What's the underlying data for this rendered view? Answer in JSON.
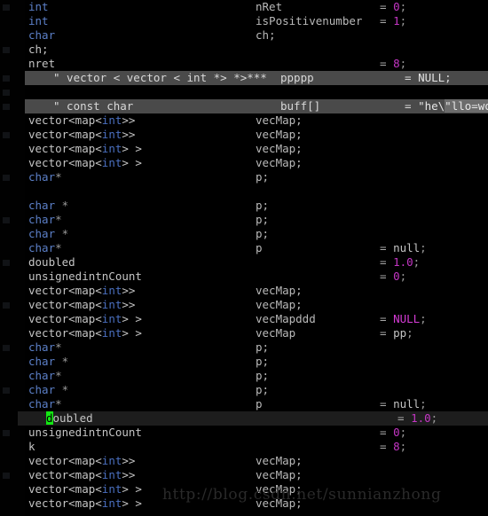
{
  "editor": {
    "background_color": "#000000",
    "highlight_color": "#4a4a4a",
    "current_line_color": "#1d1d1d",
    "cursor_color": "#13e813",
    "keyword_color": "#5b7fc7",
    "number_color": "#c536c5",
    "text_color": "#c4c4c4"
  },
  "watermark": {
    "text": "http://blog.csdn.net/sunnianzhong"
  },
  "lines": [
    {
      "type": "int",
      "name": "nRet",
      "op": "=",
      "value": "0",
      "term": ";"
    },
    {
      "type": "int",
      "name": "isPositivenumber",
      "op": "=",
      "value": "1",
      "term": ";"
    },
    {
      "type": "char",
      "name": "ch;",
      "op": "",
      "value": "",
      "term": ""
    },
    {
      "type": "ch;",
      "name": "",
      "op": "",
      "value": "",
      "term": ""
    },
    {
      "type": "nret",
      "name": "",
      "op": "=",
      "value": "8",
      "term": ";"
    },
    {
      "type": "\" vector < vector < int *> *>***",
      "name": "ppppp",
      "op": "=",
      "value": "NULL",
      "term": ";"
    },
    {
      "type": "",
      "name": "",
      "op": "",
      "value": "",
      "term": ""
    },
    {
      "type": "\" const char",
      "name": "buff[]",
      "op": "=",
      "value": "\"he\\\"llo=world\"",
      "term": ""
    },
    {
      "type": "vector<map<int>>",
      "name": "vecMap;",
      "op": "",
      "value": "",
      "term": ""
    },
    {
      "type": "vector<map<int>>",
      "name": "vecMap;",
      "op": "",
      "value": "",
      "term": ""
    },
    {
      "type": "vector<map<int> >",
      "name": "vecMap;",
      "op": "",
      "value": "",
      "term": ""
    },
    {
      "type": "vector<map<int> >",
      "name": "vecMap;",
      "op": "",
      "value": "",
      "term": ""
    },
    {
      "type": "char*",
      "name": "p;",
      "op": "",
      "value": "",
      "term": ""
    },
    {
      "type": "",
      "name": "",
      "op": "",
      "value": "",
      "term": ""
    },
    {
      "type": "char *",
      "name": "p;",
      "op": "",
      "value": "",
      "term": ""
    },
    {
      "type": "char*",
      "name": "p;",
      "op": "",
      "value": "",
      "term": ""
    },
    {
      "type": "char *",
      "name": "p;",
      "op": "",
      "value": "",
      "term": ""
    },
    {
      "type": "char*",
      "name": "p",
      "op": "=",
      "value": "null",
      "term": ";"
    },
    {
      "type": "doubled",
      "name": "",
      "op": "=",
      "value": "1.0",
      "term": ";"
    },
    {
      "type": "unsignedintnCount",
      "name": "",
      "op": "=",
      "value": "0",
      "term": ";"
    },
    {
      "type": "vector<map<int>>",
      "name": "vecMap;",
      "op": "",
      "value": "",
      "term": ""
    },
    {
      "type": "vector<map<int>>",
      "name": "vecMap;",
      "op": "",
      "value": "",
      "term": ""
    },
    {
      "type": "vector<map<int> >",
      "name": "vecMapddd",
      "op": "=",
      "value": "NULL",
      "term": ";"
    },
    {
      "type": "vector<map<int> >",
      "name": "vecMap",
      "op": "=",
      "value": "pp",
      "term": ";"
    },
    {
      "type": "char*",
      "name": "p;",
      "op": "",
      "value": "",
      "term": ""
    },
    {
      "type": "char *",
      "name": "p;",
      "op": "",
      "value": "",
      "term": ""
    },
    {
      "type": "char*",
      "name": "p;",
      "op": "",
      "value": "",
      "term": ""
    },
    {
      "type": "char *",
      "name": "p;",
      "op": "",
      "value": "",
      "term": ""
    },
    {
      "type": "char*",
      "name": "p",
      "op": "=",
      "value": "null",
      "term": ";"
    },
    {
      "type": "doubled",
      "name": "",
      "op": "=",
      "value": "1.0",
      "term": ";"
    },
    {
      "type": "unsignedintnCount",
      "name": "",
      "op": "=",
      "value": "0",
      "term": ";"
    },
    {
      "type": "k",
      "name": "",
      "op": "=",
      "value": "8",
      "term": ";"
    },
    {
      "type": "vector<map<int>>",
      "name": "vecMap;",
      "op": "",
      "value": "",
      "term": ""
    },
    {
      "type": "vector<map<int>>",
      "name": "vecMap;",
      "op": "",
      "value": "",
      "term": ""
    },
    {
      "type": "vector<map<int> >",
      "name": "vecMap;",
      "op": "",
      "value": "",
      "term": ""
    },
    {
      "type": "vector<map<int> >",
      "name": "vecMap;",
      "op": "",
      "value": "",
      "term": ""
    }
  ],
  "selection": {
    "highlighted_line_indices": [
      5,
      7
    ],
    "current_line_index": 29,
    "cursor_line_index": 29,
    "cursor_char": "d"
  },
  "strings": {
    "quote_prefix": "\"",
    "escaped_segment": "he\\",
    "string_tail": "\"llo=world\"",
    "null_literal": "NULL",
    "null_lower": "null",
    "star": "*"
  }
}
